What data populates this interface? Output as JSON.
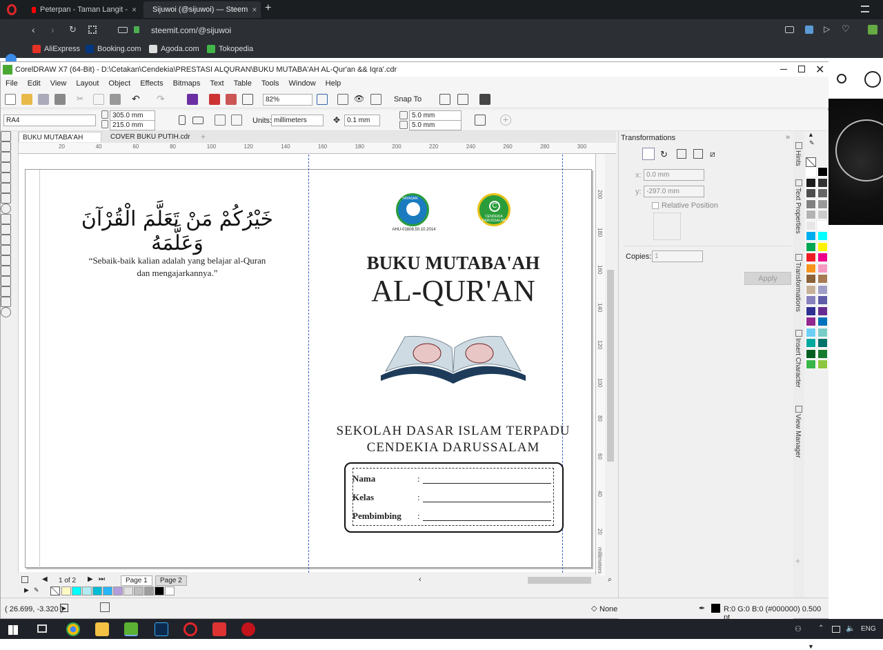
{
  "browser": {
    "tabs": [
      {
        "label": "Peterpan - Taman Langit - ",
        "close": "×"
      },
      {
        "label": "Sijuwoi (@sijuwoi) — Steem",
        "close": "×"
      }
    ],
    "new_tab": "+",
    "address": "steemit.com/@sijuwoi",
    "bookmarks": [
      "AliExpress",
      "Booking.com",
      "Agoda.com",
      "Tokopedia"
    ]
  },
  "app": {
    "title": "CorelDRAW X7 (64-Bit) - D:\\Cetakan\\Cendekia\\PRESTASI ALQURAN\\BUKU MUTABA'AH AL-Qur'an && Iqra'.cdr",
    "menu": [
      "File",
      "Edit",
      "View",
      "Layout",
      "Object",
      "Effects",
      "Bitmaps",
      "Text",
      "Table",
      "Tools",
      "Window",
      "Help"
    ],
    "zoom": "82%",
    "snap_to": "Snap To",
    "page_size": "RA4",
    "width": "305.0 mm",
    "height": "215.0 mm",
    "units_label": "Units:",
    "units": "millimeters",
    "nudge": "0.1 mm",
    "dup_x": "5.0 mm",
    "dup_y": "5.0 mm",
    "doc_tabs": [
      "BUKU MUTABA'AH AL...",
      "COVER BUKU PUTIH.cdr"
    ],
    "ruler_h": [
      "20",
      "40",
      "60",
      "80",
      "100",
      "120",
      "140",
      "160",
      "180",
      "200",
      "220",
      "240",
      "260",
      "280",
      "300"
    ],
    "ruler_v": [
      "200",
      "180",
      "160",
      "140",
      "120",
      "100",
      "80",
      "60",
      "40",
      "20"
    ],
    "ruler_unit": "millimeters"
  },
  "document": {
    "arabic": "خَيْرُكُمْ مَنْ تَعَلَّمَ الْقُرْآنَ وَعَلَّمَهُ",
    "quote_line1": "“Sebaik-baik kalian adalah yang belajar al-Quran",
    "quote_line2": "dan mengajarkannya.”",
    "logo1_caption": "AHU-01608.50.10.2014",
    "logo1_top": "YAYASAN",
    "logo2_text": "CENDEKIA DARUSSALAM",
    "title_line1": "BUKU MUTABA'AH",
    "title_line2": "AL-QUR'AN",
    "school_line1": "SEKOLAH DASAR ISLAM TERPADU",
    "school_line2": "CENDEKIA DARUSSALAM",
    "form": [
      {
        "label": "Nama",
        "sep": ":"
      },
      {
        "label": "Kelas",
        "sep": ":"
      },
      {
        "label": "Pembimbing",
        "sep": ":"
      }
    ]
  },
  "docker": {
    "title": "Transformations",
    "x_label": "x:",
    "x_value": "0.0 mm",
    "y_label": "y:",
    "y_value": "-297.0 mm",
    "relative": "Relative Position",
    "copies_label": "Copies:",
    "copies": "1",
    "apply": "Apply",
    "vtabs": [
      "Hints",
      "Text Properties",
      "Transformations",
      "Insert Character",
      "View Manager"
    ]
  },
  "pagenav": {
    "counter": "1 of 2",
    "pages": [
      "Page 1",
      "Page 2"
    ]
  },
  "status": {
    "coords": "( 26.699, -3.320 )",
    "fill": "None",
    "outline": "R:0 G:0 B:0 (#000000) 0.500 pt"
  },
  "taskbar": {
    "lang": "ENG"
  },
  "palette_colors": [
    "#ffffff",
    "#000000",
    "#1a1a1a",
    "#333333",
    "#4d4d4d",
    "#666666",
    "#808080",
    "#999999",
    "#b3b3b3",
    "#cccccc",
    "#e6e6e6",
    "#ffffff",
    "#00aeef",
    "#00ffff",
    "#00a651",
    "#fff200",
    "#ed1c24",
    "#ec008c",
    "#f7941d",
    "#f49ac1",
    "#8c6239",
    "#a67c52",
    "#c7b299",
    "#9e9ec7",
    "#8781bd",
    "#605ca8",
    "#2e3192",
    "#662d91",
    "#92278f",
    "#0072bc",
    "#6dcff6",
    "#7accc8",
    "#00a99d",
    "#00746b",
    "#005e20",
    "#197b30",
    "#39b54a",
    "#8dc63f"
  ],
  "doc_palette": [
    "#fff9c4",
    "#00ffff",
    "#b2ebf2",
    "#00bcd4",
    "#29b6f6",
    "#b39ddb",
    "#e0e0e0",
    "#bdbdbd",
    "#9e9e9e",
    "#000000",
    "#ffffff"
  ]
}
